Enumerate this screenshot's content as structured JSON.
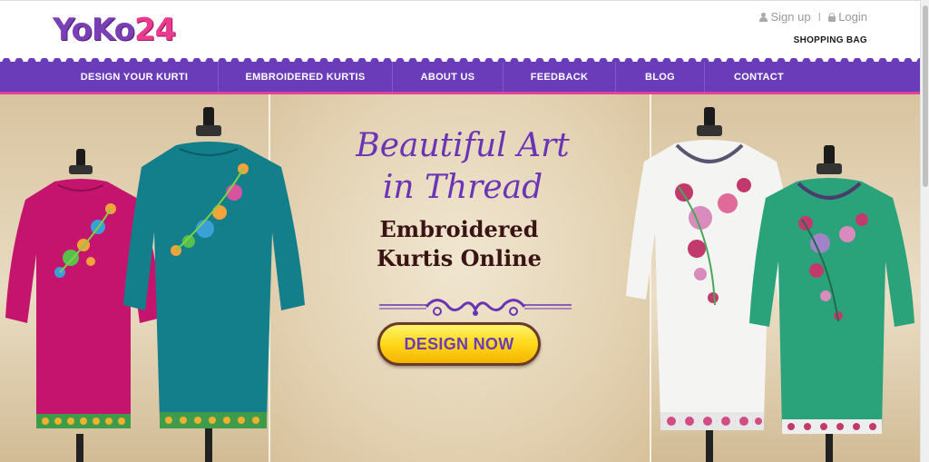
{
  "header": {
    "logo_part1": "YoKo",
    "logo_part2": "24",
    "sign_up": "Sign up",
    "separator": "I",
    "login": "Login",
    "shopping_bag": "SHOPPING BAG"
  },
  "nav": {
    "items": [
      {
        "label": "DESIGN YOUR KURTI"
      },
      {
        "label": "EMBROIDERED KURTIS"
      },
      {
        "label": "ABOUT US"
      },
      {
        "label": "FEEDBACK"
      },
      {
        "label": "BLOG"
      },
      {
        "label": "CONTACT"
      }
    ]
  },
  "hero": {
    "headline_line1": "Beautiful Art",
    "headline_line2": "in Thread",
    "subheadline_line1": "Embroidered",
    "subheadline_line2": "Kurtis Online",
    "cta_label": "DESIGN NOW"
  },
  "colors": {
    "brand_purple": "#6a3cba",
    "brand_pink": "#e0419a",
    "cta_yellow": "#ffd81a",
    "headline_purple": "#6b34b5",
    "subheadline_brown": "#3a1414"
  },
  "icons": {
    "user": "user-icon",
    "lock": "lock-icon"
  }
}
